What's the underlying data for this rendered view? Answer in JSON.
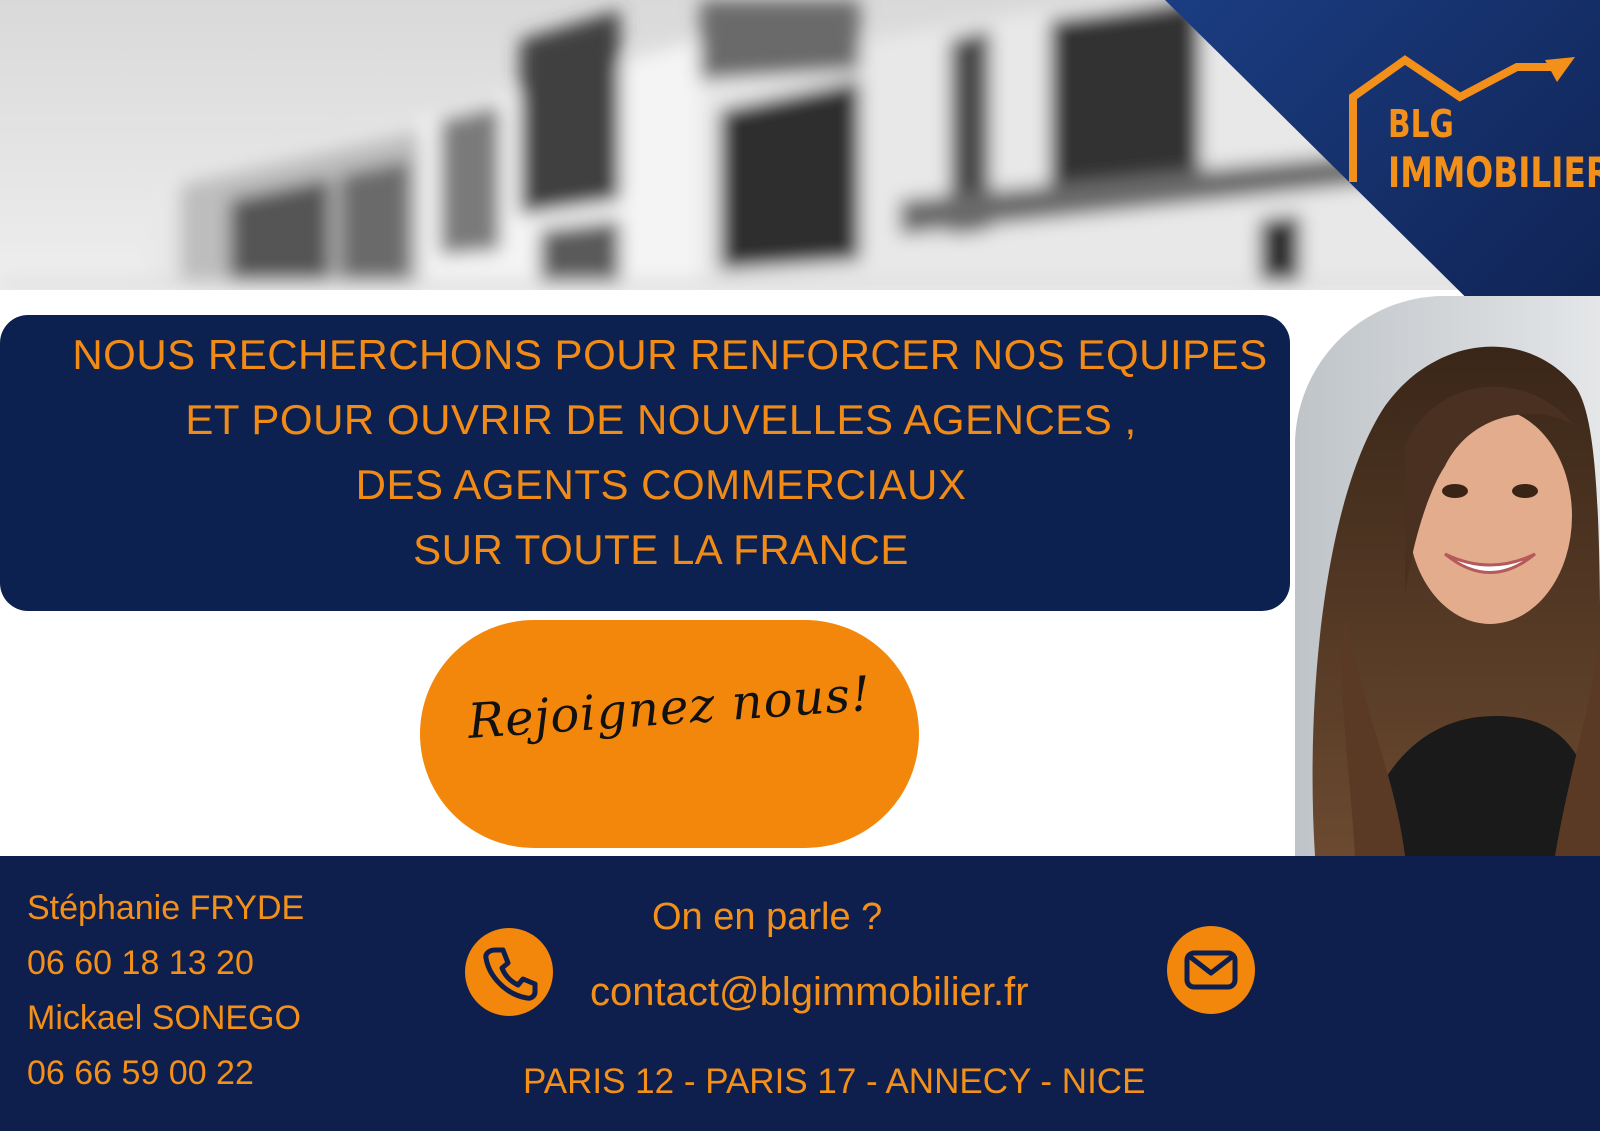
{
  "brand": {
    "logo_line1": "BLG",
    "logo_line2": "IMMOBILIER",
    "navy": "#0d2150",
    "orange": "#f3870c"
  },
  "message": {
    "line1": "NOUS RECHERCHONS POUR RENFORCER NOS EQUIPES",
    "line2": "ET POUR OUVRIR DE NOUVELLES AGENCES ,",
    "line3": "DES AGENTS COMMERCIAUX",
    "line4": "SUR TOUTE LA FRANCE"
  },
  "cta": {
    "label": "Rejoignez nous!"
  },
  "footer": {
    "contacts": [
      {
        "name": "Stéphanie FRYDE",
        "phone": "06 60 18 13 20"
      },
      {
        "name": "Mickael SONEGO",
        "phone": "06 66 59 00 22"
      }
    ],
    "talk": "On en parle ?",
    "email": "contact@blgimmobilier.fr",
    "cities": "PARIS  12 - PARIS 17 - ANNECY - NICE",
    "icons": [
      "phone-icon",
      "mail-icon"
    ]
  }
}
